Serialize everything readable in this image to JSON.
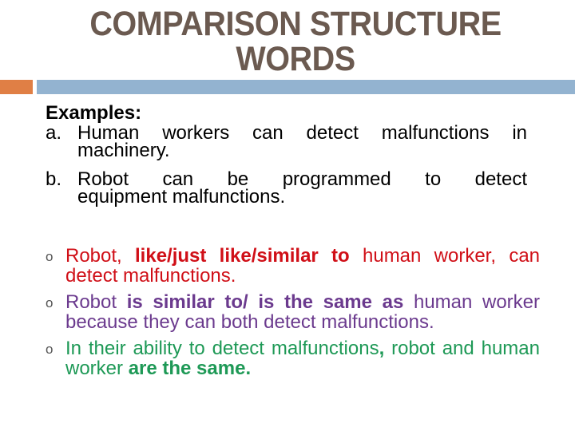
{
  "title": {
    "line1": "COMPARISON STRUCTURE",
    "line2": "WORDS"
  },
  "colors": {
    "title": "#6b5a50",
    "accent_orange": "#e07f45",
    "accent_blue": "#93b3d0",
    "red": "#d00f17",
    "purple": "#6b3a8e",
    "green": "#1e9956"
  },
  "examples": {
    "heading": "Examples:",
    "items": [
      {
        "marker": "a.",
        "line1": "Human workers can detect malfunctions in",
        "line2": "machinery."
      },
      {
        "marker": "b.",
        "line1": "Robot can be programmed to detect",
        "line2": "equipment malfunctions."
      }
    ]
  },
  "bullets": [
    {
      "marker_icon": "hollow-circle-bullet",
      "marker": "o",
      "color": "red",
      "parts": [
        {
          "text": "Robot, ",
          "bold": false
        },
        {
          "text": "like/just like/similar to",
          "bold": true
        },
        {
          "text": " human worker, can detect malfunctions.",
          "bold": false
        }
      ]
    },
    {
      "marker_icon": "hollow-circle-bullet",
      "marker": "o",
      "color": "purple",
      "parts": [
        {
          "text": "Robot ",
          "bold": false
        },
        {
          "text": "is similar to/ is the same as",
          "bold": true
        },
        {
          "text": " human worker because they can both detect malfunctions.",
          "bold": false
        }
      ]
    },
    {
      "marker_icon": "hollow-circle-bullet",
      "marker": "o",
      "color": "green",
      "parts": [
        {
          "text": "In their  ability to detect malfunctions",
          "bold": false
        },
        {
          "text": ",",
          "bold": true
        },
        {
          "text": " robot and human worker ",
          "bold": false
        },
        {
          "text": "are the same.",
          "bold": true
        }
      ]
    }
  ]
}
